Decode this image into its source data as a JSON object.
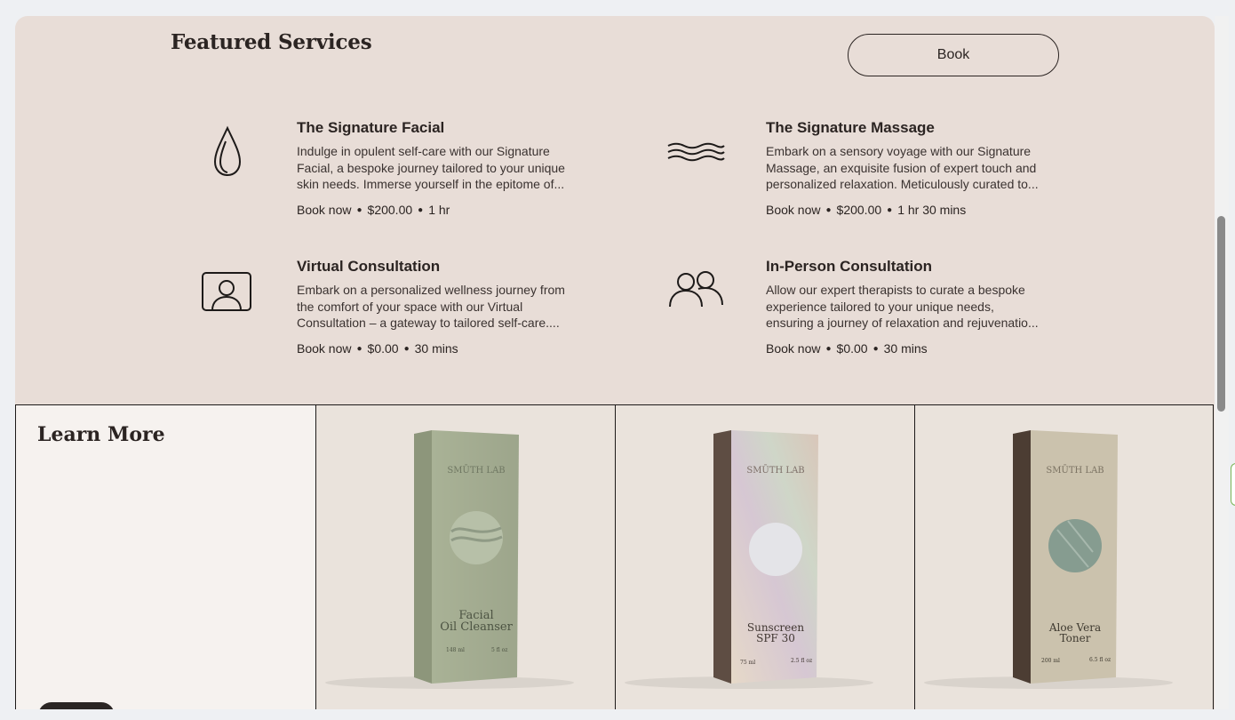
{
  "featured": {
    "title": "Featured Services",
    "book_label": "Book",
    "services": [
      {
        "icon": "droplet-icon",
        "title": "The Signature Facial",
        "desc_lines": [
          "Indulge in opulent self-care with our Signature",
          "Facial, a bespoke journey tailored to your unique",
          "skin needs. Immerse yourself in the epitome of..."
        ],
        "book_now": "Book now",
        "price": "$200.00",
        "duration": "1 hr"
      },
      {
        "icon": "waves-icon",
        "title": "The Signature Massage",
        "desc_lines": [
          "Embark on a sensory voyage with our Signature",
          "Massage, an exquisite fusion of expert touch and",
          "personalized relaxation. Meticulously curated to..."
        ],
        "book_now": "Book now",
        "price": "$200.00",
        "duration": "1 hr 30 mins"
      },
      {
        "icon": "video-person-icon",
        "title": "Virtual Consultation",
        "desc_lines": [
          "Embark on a personalized wellness journey from",
          "the comfort of your space with our Virtual",
          "Consultation – a gateway to tailored self-care...."
        ],
        "book_now": "Book now",
        "price": "$0.00",
        "duration": "30 mins"
      },
      {
        "icon": "two-people-icon",
        "title": "In-Person Consultation",
        "desc_lines": [
          "Allow our expert therapists to curate a bespoke",
          "experience tailored to your unique needs,",
          "ensuring a journey of relaxation and rejuvenatio..."
        ],
        "book_now": "Book now",
        "price": "$0.00",
        "duration": "30 mins"
      }
    ]
  },
  "learn_more": {
    "title": "Learn More",
    "products": [
      {
        "brand": "SMŪTH LAB",
        "name_line1": "Facial",
        "name_line2": "Oil Cleanser",
        "size_left": "148 ml",
        "size_right": "5 fl oz",
        "box_color": "#a9b296",
        "side_color": "#8d967b",
        "circle_color": "#b7c0a8"
      },
      {
        "brand": "SMŪTH LAB",
        "name_line1": "Sunscreen",
        "name_line2": "SPF 30",
        "size_left": "75 ml",
        "size_right": "2.5 fl oz",
        "box_color": "#d5c7bb",
        "side_color": "#5e4d43",
        "circle_color": "#e4e4e8"
      },
      {
        "brand": "SMŪTH LAB",
        "name_line1": "Aloe Vera",
        "name_line2": "Toner",
        "size_left": "200 ml",
        "size_right": "6.5 fl oz",
        "box_color": "#cbc2ad",
        "side_color": "#4c3d33",
        "circle_color": "#869c90"
      }
    ]
  }
}
